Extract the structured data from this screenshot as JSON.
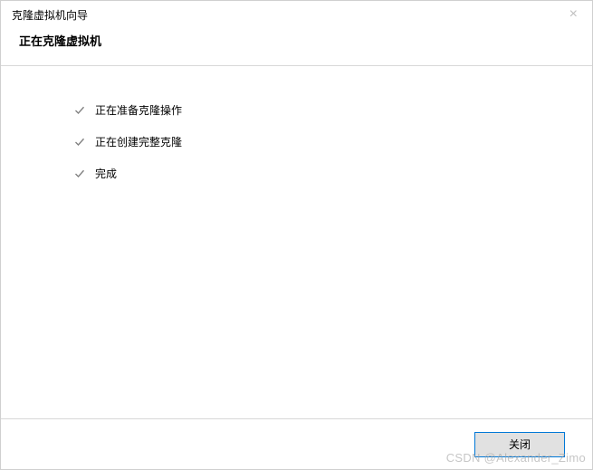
{
  "window": {
    "title": "克隆虚拟机向导"
  },
  "header": {
    "title": "正在克隆虚拟机"
  },
  "steps": [
    {
      "label": "正在准备克隆操作"
    },
    {
      "label": "正在创建完整克隆"
    },
    {
      "label": "完成"
    }
  ],
  "footer": {
    "close_label": "关闭"
  },
  "watermark": "CSDN @Alexander_Zimo"
}
